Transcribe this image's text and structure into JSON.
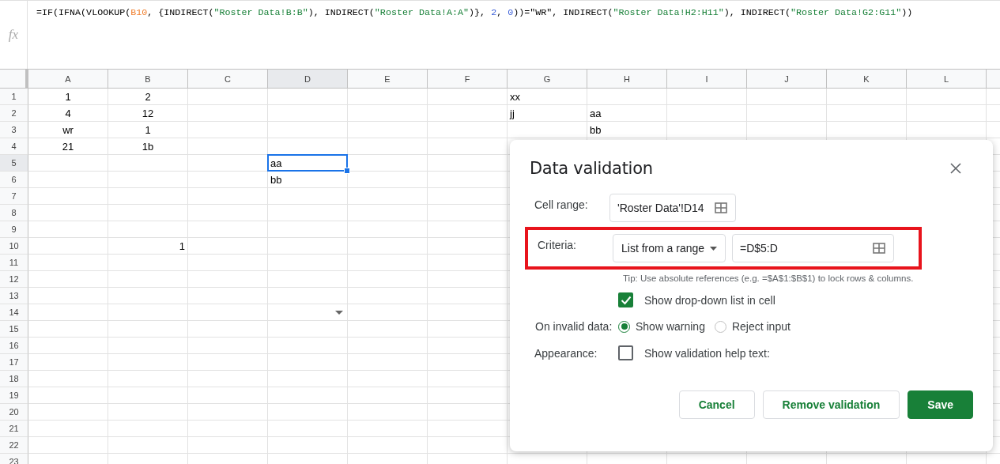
{
  "formula_bar": {
    "label": "fx",
    "formula": [
      {
        "text": "=IF(IFNA(VLOOKUP(",
        "kind": "plain"
      },
      {
        "text": "B10",
        "kind": "ref"
      },
      {
        "text": ", {INDIRECT(",
        "kind": "plain"
      },
      {
        "text": "\"Roster Data!B:B\"",
        "kind": "string"
      },
      {
        "text": "), INDIRECT(",
        "kind": "plain"
      },
      {
        "text": "\"Roster Data!A:A\"",
        "kind": "string"
      },
      {
        "text": ")}, ",
        "kind": "plain"
      },
      {
        "text": "2",
        "kind": "number"
      },
      {
        "text": ", ",
        "kind": "plain"
      },
      {
        "text": "0",
        "kind": "number"
      },
      {
        "text": "))=\"WR\", INDIRECT(",
        "kind": "plain"
      },
      {
        "text": "\"Roster Data!H2:H11\"",
        "kind": "string"
      },
      {
        "text": "), INDIRECT(",
        "kind": "plain"
      },
      {
        "text": "\"Roster Data!G2:G11\"",
        "kind": "string"
      },
      {
        "text": "))",
        "kind": "plain"
      }
    ]
  },
  "sheet": {
    "columns": [
      {
        "label": "A",
        "selected": false
      },
      {
        "label": "B",
        "selected": false
      },
      {
        "label": "C",
        "selected": false
      },
      {
        "label": "D",
        "selected": true
      },
      {
        "label": "E",
        "selected": false
      },
      {
        "label": "F",
        "selected": false
      },
      {
        "label": "G",
        "selected": false
      },
      {
        "label": "H",
        "selected": false
      },
      {
        "label": "I",
        "selected": false
      },
      {
        "label": "J",
        "selected": false
      },
      {
        "label": "K",
        "selected": false
      },
      {
        "label": "L",
        "selected": false
      }
    ],
    "rows": [
      {
        "label": "1",
        "selected": false,
        "cells": [
          {
            "kind": "centered",
            "text": "1",
            "selected": false
          },
          {
            "kind": "centered",
            "text": "2",
            "selected": false
          },
          null,
          null,
          null,
          null,
          {
            "kind": "left",
            "text": "xx",
            "selected": false
          }
        ]
      },
      {
        "label": "2",
        "selected": false,
        "cells": [
          {
            "kind": "centered",
            "text": "4",
            "selected": false
          },
          {
            "kind": "centered",
            "text": "12",
            "selected": false
          },
          null,
          null,
          null,
          null,
          {
            "kind": "left",
            "text": "jj",
            "selected": false
          },
          {
            "kind": "left",
            "text": "aa",
            "selected": false
          }
        ]
      },
      {
        "label": "3",
        "selected": false,
        "cells": [
          {
            "kind": "centered",
            "text": "wr",
            "selected": false
          },
          {
            "kind": "centered",
            "text": "1",
            "selected": false
          },
          null,
          null,
          null,
          null,
          null,
          {
            "kind": "left",
            "text": "bb",
            "selected": false
          }
        ]
      },
      {
        "label": "4",
        "selected": false,
        "cells": [
          {
            "kind": "centered",
            "text": "21",
            "selected": false
          },
          {
            "kind": "centered",
            "text": "1b",
            "selected": false
          }
        ]
      },
      {
        "label": "5",
        "selected": true,
        "cells": [
          null,
          null,
          null,
          {
            "kind": "left",
            "text": "aa",
            "selected": true
          }
        ]
      },
      {
        "label": "6",
        "selected": false,
        "cells": [
          null,
          null,
          null,
          {
            "kind": "left",
            "text": "bb",
            "selected": false
          }
        ]
      },
      {
        "label": "7",
        "selected": false,
        "cells": []
      },
      {
        "label": "8",
        "selected": false,
        "cells": []
      },
      {
        "label": "9",
        "selected": false,
        "cells": []
      },
      {
        "label": "10",
        "selected": false,
        "cells": [
          null,
          {
            "kind": "right",
            "text": "1",
            "selected": false
          }
        ]
      },
      {
        "label": "11",
        "selected": false,
        "cells": []
      },
      {
        "label": "12",
        "selected": false,
        "cells": []
      },
      {
        "label": "13",
        "selected": false,
        "cells": []
      },
      {
        "label": "14",
        "selected": false,
        "cells": [
          null,
          null,
          null,
          {
            "kind": "dropdown"
          }
        ]
      },
      {
        "label": "15",
        "selected": false,
        "cells": []
      },
      {
        "label": "16",
        "selected": false,
        "cells": []
      },
      {
        "label": "17",
        "selected": false,
        "cells": []
      },
      {
        "label": "18",
        "selected": false,
        "cells": []
      },
      {
        "label": "19",
        "selected": false,
        "cells": []
      },
      {
        "label": "20",
        "selected": false,
        "cells": []
      },
      {
        "label": "21",
        "selected": false,
        "cells": []
      },
      {
        "label": "22",
        "selected": false,
        "cells": []
      },
      {
        "label": "23",
        "selected": false,
        "cells": []
      }
    ]
  },
  "dialog": {
    "title": "Data validation",
    "cell_range": {
      "label": "Cell range:",
      "value": "'Roster Data'!D14"
    },
    "criteria": {
      "label": "Criteria:",
      "type": "List from a range",
      "value": "=D$5:D",
      "highlighted": true
    },
    "tip": "Tip: Use absolute references (e.g. =$A$1:$B$1) to lock rows & columns.",
    "show_dropdown": {
      "label": "Show drop-down list in cell",
      "checked": true
    },
    "invalid_data": {
      "label": "On invalid data:",
      "options": [
        {
          "label": "Show warning",
          "selected": true
        },
        {
          "label": "Reject input",
          "selected": false
        }
      ]
    },
    "appearance": {
      "label": "Appearance:",
      "checkbox": {
        "label": "Show validation help text:",
        "checked": false
      }
    },
    "buttons": [
      {
        "label": "Cancel",
        "kind": "secondary"
      },
      {
        "label": "Remove validation",
        "kind": "secondary"
      },
      {
        "label": "Save",
        "kind": "primary"
      }
    ]
  }
}
